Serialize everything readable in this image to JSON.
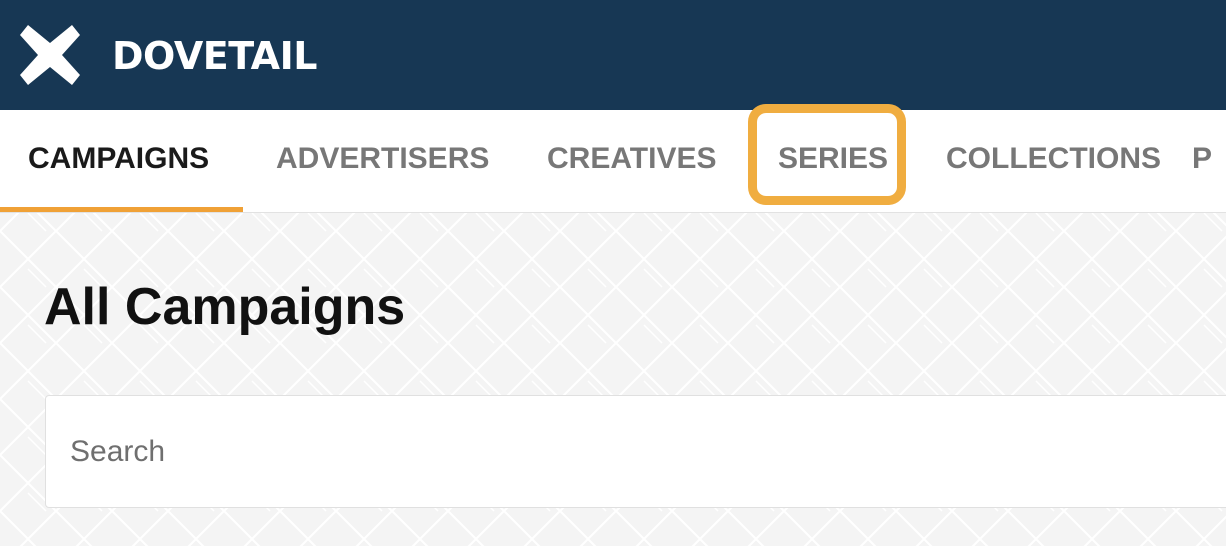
{
  "app": {
    "brand": "DOVETAIL",
    "logo_icon": "dovetail-x-logo-icon",
    "header_color": "#173754"
  },
  "tabs": [
    {
      "label": "CAMPAIGNS",
      "active": true
    },
    {
      "label": "ADVERTISERS",
      "active": false
    },
    {
      "label": "CREATIVES",
      "active": false
    },
    {
      "label": "SERIES",
      "active": false,
      "highlighted": true
    },
    {
      "label": "COLLECTIONS",
      "active": false
    },
    {
      "label": "P",
      "active": false
    }
  ],
  "colors": {
    "active_underline": "#f0a136",
    "highlight_box": "#f0ad40"
  },
  "main": {
    "title": "All Campaigns",
    "search": {
      "placeholder": "Search",
      "value": ""
    }
  }
}
